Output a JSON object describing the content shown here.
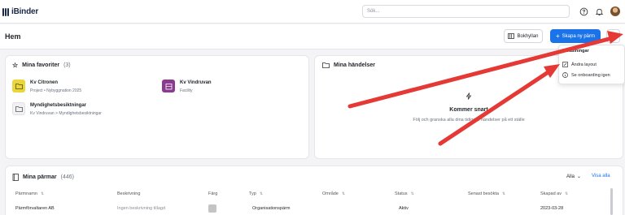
{
  "app": {
    "logo_text": "iBinder"
  },
  "search": {
    "placeholder": "Sök..."
  },
  "header": {
    "title": "Hem",
    "bookshelf_label": "Bokhyllan",
    "create_label": "Skapa ny pärm"
  },
  "settings_menu": {
    "heading": "Inställningar",
    "items": [
      {
        "label": "Ändra layout",
        "icon": "edit-layout-icon"
      },
      {
        "label": "Se onboarding igen",
        "icon": "info-icon"
      }
    ]
  },
  "favorites": {
    "title": "Mina favoriter",
    "count": "(3)",
    "items": [
      {
        "name": "Kv Citronen",
        "subtitle": "Project • Nybyggnation 2025",
        "color": "#e9d63a"
      },
      {
        "name": "Kv Vindruvan",
        "subtitle": "Facility",
        "color": "#8a3b8f"
      },
      {
        "name": "Myndighetsbesiktningar",
        "subtitle": "Kv Vindruvan  >  Myndighetsbesiktningar",
        "color": "#f1f1f3"
      }
    ]
  },
  "events": {
    "title": "Mina händelser",
    "coming_soon": "Kommer snart",
    "coming_soon_sub": "Följ och granska alla dina tidigare händelser på ett ställe"
  },
  "binders": {
    "title": "Mina pärmar",
    "count": "(446)",
    "filter": "Alla",
    "see_all": "Visa alla",
    "columns": [
      "Pärmnamn",
      "Beskrivning",
      "Färg",
      "Typ",
      "Område",
      "Status",
      "Senast besökta",
      "Skapad av"
    ],
    "rows": [
      {
        "name": "Pärmförvaltaren AB",
        "description": "Ingen beskrivning tillagd",
        "color": "#c4c4c4",
        "type": "Organisationspärm",
        "area": "",
        "status": "Aktiv",
        "last_visited": "",
        "created": "2023-03-28"
      }
    ]
  },
  "colors": {
    "accent": "#1a73e8",
    "annotation_arrow": "#e53935"
  }
}
